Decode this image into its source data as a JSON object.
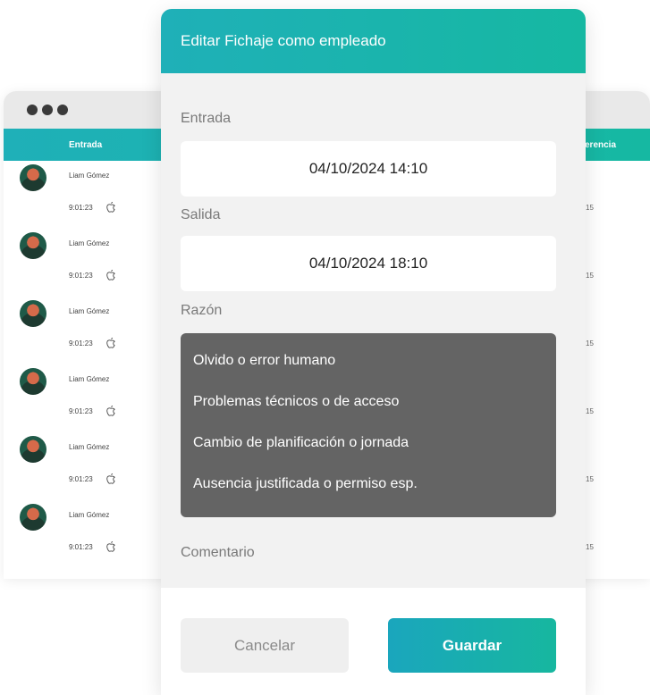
{
  "background_window": {
    "columns": {
      "entrada": "Entrada",
      "diferencia": "erencia"
    },
    "rows": [
      {
        "name": "Liam Gómez",
        "time": "9:01:23",
        "diff": "15"
      },
      {
        "name": "Liam Gómez",
        "time": "9:01:23",
        "diff": "15"
      },
      {
        "name": "Liam Gómez",
        "time": "9:01:23",
        "diff": "15"
      },
      {
        "name": "Liam Gómez",
        "time": "9:01:23",
        "diff": "15"
      },
      {
        "name": "Liam Gómez",
        "time": "9:01:23",
        "diff": "15"
      },
      {
        "name": "Liam Gómez",
        "time": "9:01:23",
        "diff": "15"
      }
    ]
  },
  "modal": {
    "title": "Editar Fichaje como empleado",
    "entrada_label": "Entrada",
    "entrada_value": "04/10/2024 14:10",
    "salida_label": "Salida",
    "salida_value": "04/10/2024 18:10",
    "razon_label": "Razón",
    "razon_options": [
      "Olvido o error humano",
      "Problemas técnicos o de acceso",
      "Cambio de planificación o jornada",
      "Ausencia justificada o permiso esp."
    ],
    "comentario_label": "Comentario",
    "cancel_label": "Cancelar",
    "save_label": "Guardar"
  },
  "colors": {
    "accent": "#1fb0b8",
    "accent_2": "#16b8a2",
    "dropdown_bg": "#646464"
  }
}
